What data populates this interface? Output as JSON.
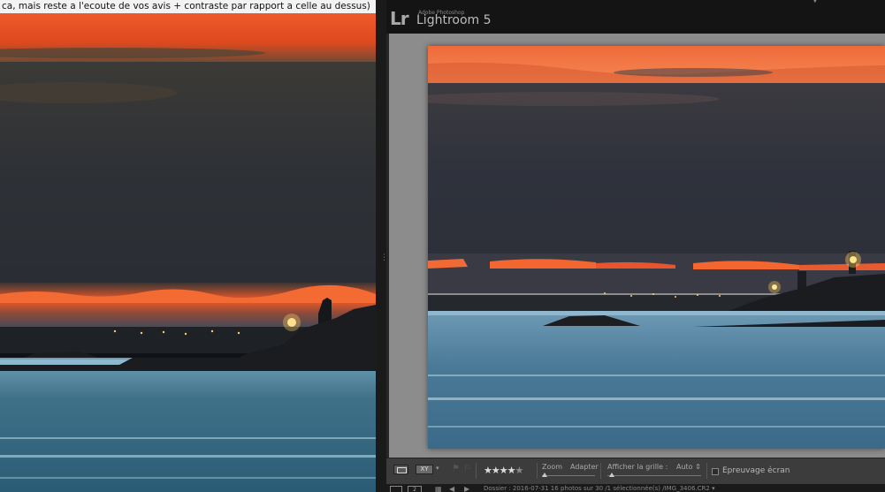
{
  "left_pane": {
    "caption": "ca, mais reste a l'ecoute de vos avis + contraste par rapport a celle au dessus)"
  },
  "lightroom": {
    "logo": "Lr",
    "brand_small": "Adobe Photoshop",
    "brand_name": "Lightroom 5",
    "toolbar": {
      "compare_label": "XY",
      "rating": "★★★★★",
      "rating_value": 4,
      "zoom_label": "Zoom",
      "zoom_value": "Adapter",
      "grid_label": "Afficher la grille :",
      "grid_value": "Auto ⇕",
      "proof_label": "Epreuvage écran"
    },
    "filmstrip": {
      "status": "Dossier : 2016-07-31     16 photos sur 30 /1 sélectionnée(s) /IMG_3406.CR2 ▾"
    }
  },
  "colors": {
    "sky_orange": "#e9552a",
    "cloud_dark": "#2f3340",
    "sea_blue": "#3c6f8c",
    "lr_bg": "#262626",
    "lr_canvas": "#8c8c8c"
  }
}
